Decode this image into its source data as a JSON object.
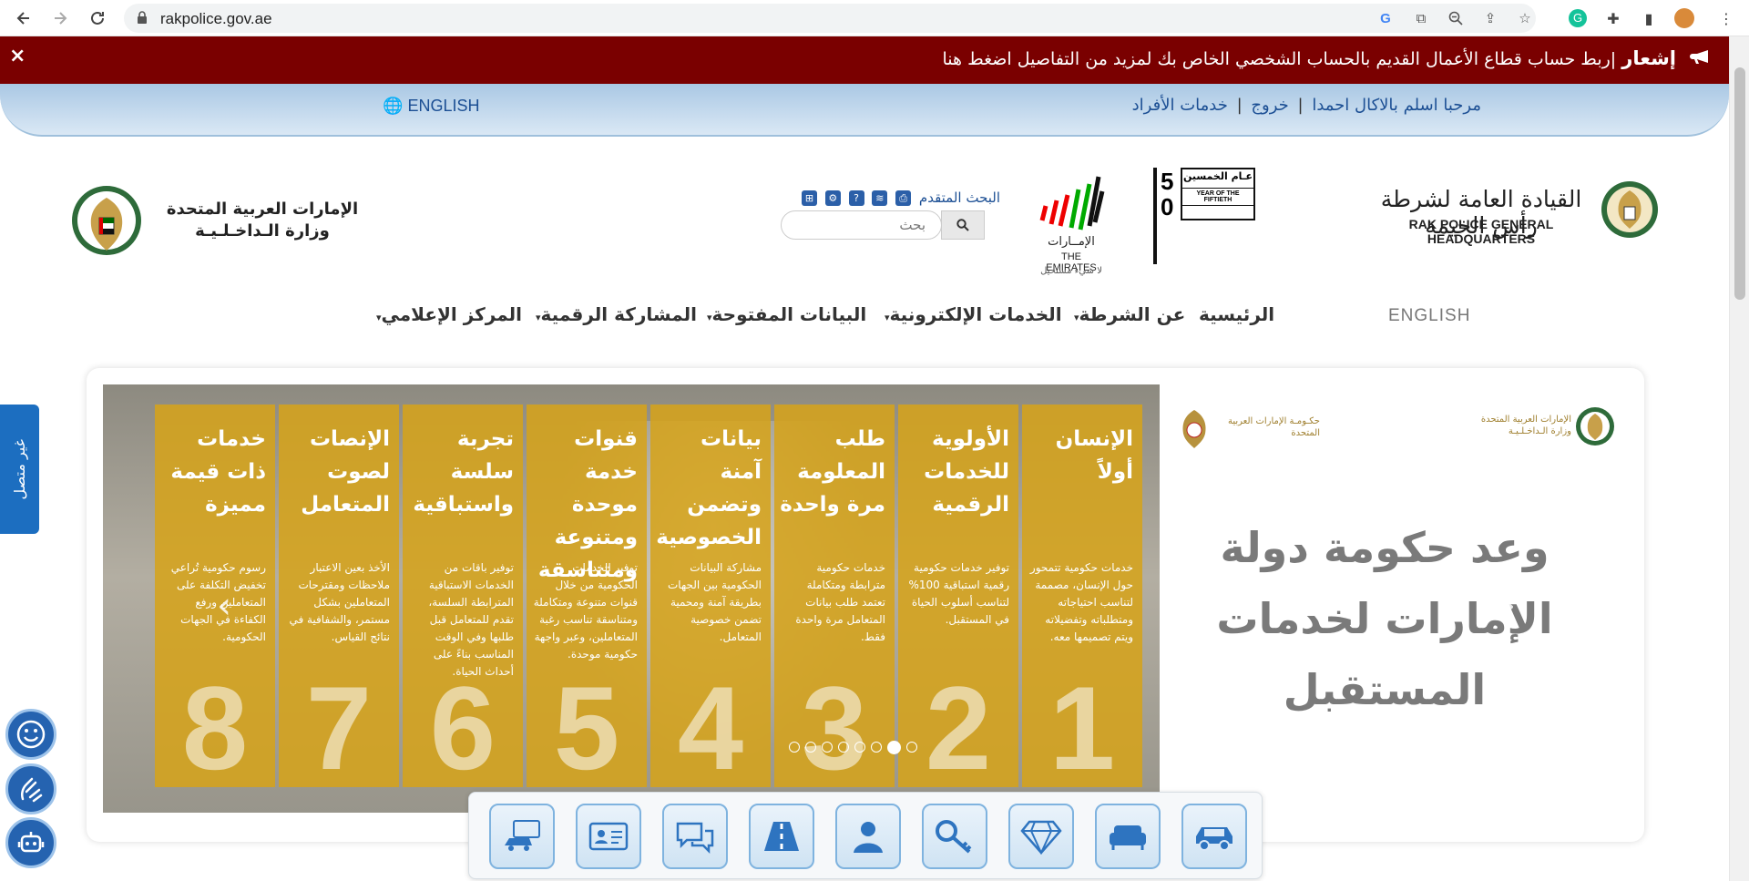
{
  "browser": {
    "url": "rakpolice.gov.ae"
  },
  "notice": {
    "close": "×",
    "label": "إشعار",
    "message": "|ربط حساب قطاع الأعمال القديم بالحساب الشخصي الخاص بك لمزيد من التفاصيل اضغط هنا"
  },
  "userbar": {
    "english": "ENGLISH",
    "welcome": "مرحبا اسلم بالاكال احمدا",
    "logout": "خروج",
    "services": "خدمات الأفراد",
    "separator": "|"
  },
  "header": {
    "moi_line1": "الإمارات العربية المتحدة",
    "moi_line2": "وزارة الـداخـلـيـة",
    "advanced_search": "البحث المتقدم",
    "search_placeholder": "بحث",
    "emirates_ar": "الإمــارات",
    "emirates_en": "THE EMIRATES",
    "emirates_slogan": "لا شيء مستحيل",
    "fifty_ar": "عـام الخمسين",
    "fifty_en": "YEAR OF THE FIFTIETH",
    "fifty_num1": "5",
    "fifty_num2": "0",
    "rak_ar": "القيادة العامة لشرطة رأس الخيمة",
    "rak_en": "RAK POLICE GENERAL HEADQUARTERS"
  },
  "nav": {
    "english": "ENGLISH",
    "items": [
      {
        "label": "الرئيسية"
      },
      {
        "label": "عن الشرطة"
      },
      {
        "label": "الخدمات الإلكترونية"
      },
      {
        "label": "البيانات المفتوحة"
      },
      {
        "label": "المشاركة الرقمية"
      },
      {
        "label": "المركز الإعلامي"
      }
    ]
  },
  "slide": {
    "promise": "وعد حكومة دولة الإمارات لخدمات المستقبل",
    "gov_left_ar": "حكـومـة الإمارات العربية المتحدة",
    "gov_right_ar": "الإمارات العربية المتحدة وزارة الـداخـلـيـة",
    "panels": [
      {
        "num": "1",
        "title": "الإنسان أولاً",
        "body": "خدمات حكومية تتمحور حول الإنسان، مصممة لتناسب احتياجاته ومتطلباته وتفضيلاته ويتم تصميمها معه."
      },
      {
        "num": "2",
        "title": "الأولوية للخدمات الرقمية",
        "body": "توفير خدمات حكومية رقمية استباقية 100% لتناسب أسلوب الحياة في المستقبل."
      },
      {
        "num": "3",
        "title": "طلب المعلومة مرة واحدة",
        "body": "خدمات حكومية مترابطة ومتكاملة تعتمد طلب بيانات المتعامل مرة واحدة فقط."
      },
      {
        "num": "4",
        "title": "بيانات آمنة وتضمن الخصوصية",
        "body": "مشاركة البيانات الحكومية بين الجهات بطريقة آمنة ومحمية تضمن خصوصية المتعامل."
      },
      {
        "num": "5",
        "title": "قنوات خدمة موحدة ومتنوعة ومتناسقة",
        "body": "توفير الخدمات الحكومية من خلال قنوات متنوعة ومتكاملة ومتناسقة تناسب رغبة المتعاملين، وعبر واجهة حكومية موحدة."
      },
      {
        "num": "6",
        "title": "تجربة سلسة واستباقية",
        "body": "توفير باقات من الخدمات الاستباقية المترابطة السلسة، تقدم للمتعامل قبل طلبها وفي الوقت المناسب بناءً على أحداث الحياة."
      },
      {
        "num": "7",
        "title": "الإنصات لصوت المتعامل",
        "body": "الأخذ بعين الاعتبار ملاحظات ومقترحات المتعاملين بشكل مستمر، والشفافية في نتائج القياس."
      },
      {
        "num": "8",
        "title": "خدمات ذات قيمة مميزة",
        "body": "رسوم حكومية تُراعي تخفيض التكلفة على المتعاملين ورفع الكفاءة في الجهات الحكومية."
      }
    ],
    "dots_count": 8,
    "active_dot": 7
  },
  "services": [
    {
      "icon": "car-icon"
    },
    {
      "icon": "sofa-icon"
    },
    {
      "icon": "diamond-icon"
    },
    {
      "icon": "key-icon"
    },
    {
      "icon": "person-icon"
    },
    {
      "icon": "road-icon"
    },
    {
      "icon": "chat-bubbles-icon"
    },
    {
      "icon": "id-card-icon"
    },
    {
      "icon": "vehicle-license-icon"
    }
  ],
  "side": {
    "tab_label": "غير متصل"
  },
  "colors": {
    "notice_bg": "#7a0000",
    "link_blue": "#1c4f94",
    "panel_gold": "#d6a318",
    "widget_blue": "#2563b0"
  }
}
